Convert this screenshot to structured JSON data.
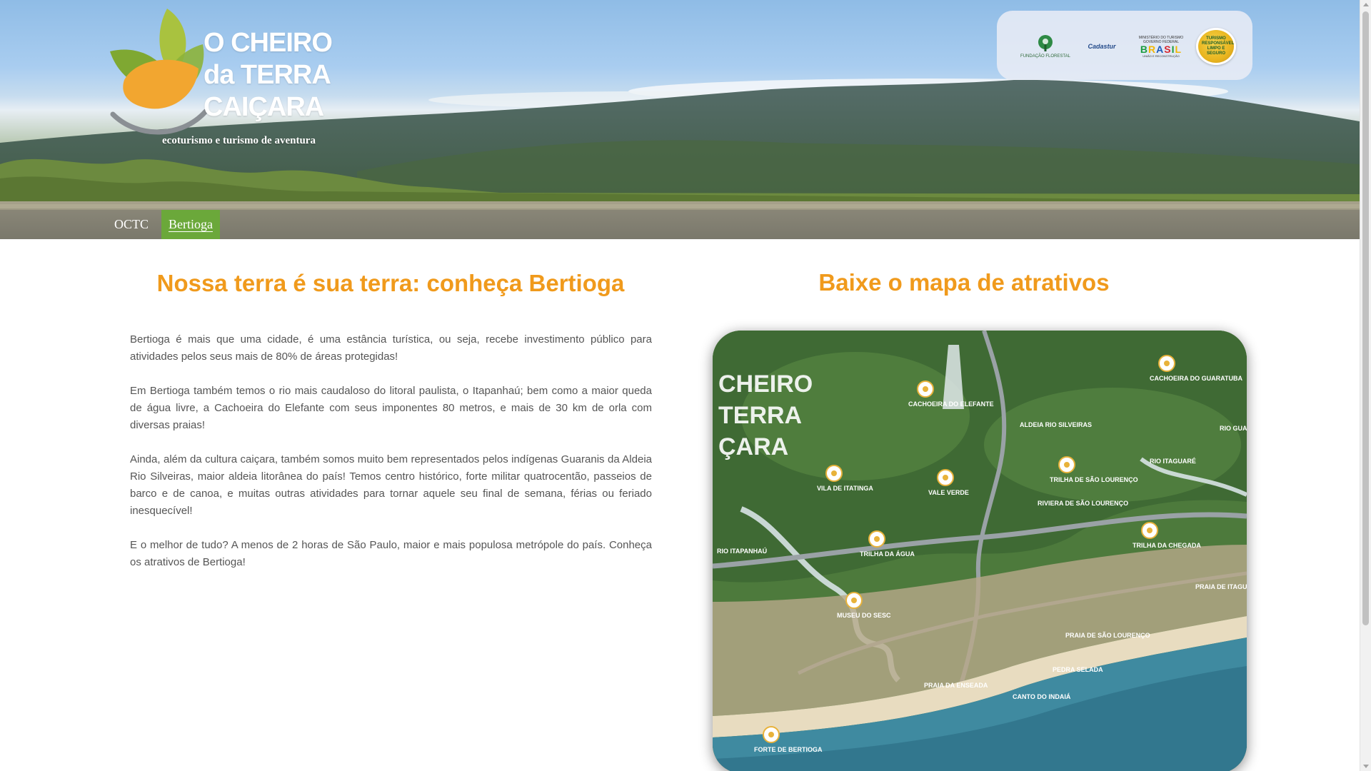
{
  "header": {
    "logo_text": "O CHEIRO\nda TERRA\nCAIÇARA",
    "tagline": "ecoturismo e turismo de aventura"
  },
  "partners": {
    "fundacao": "FUNDAÇÃO FLORESTAL",
    "cadastur": "Cadastur",
    "brasil_top": "MINISTÉRIO DO TURISMO",
    "brasil_mid": "GOVERNO FEDERAL",
    "brasil_word": [
      "B",
      "R",
      "A",
      "S",
      "I",
      "L"
    ],
    "brasil_sub": "UNIÃO E RECONSTRUÇÃO",
    "turismo_seal": "TURISMO RESPONSÁVEL LIMPO E SEGURO"
  },
  "nav": {
    "items": [
      {
        "label": "OCTC"
      },
      {
        "label": "Bertioga",
        "active": true
      }
    ]
  },
  "left": {
    "title": "Nossa terra é sua terra: conheça Bertioga",
    "paragraphs": [
      "Bertioga é mais que uma cidade, é uma estância turística, ou seja, recebe investimento público para atividades pelos seus mais de 80% de áreas protegidas!",
      "Em Bertioga também temos o rio mais caudaloso do litoral paulista, o Itapanhaú; bem como a maior queda de água livre, a Cachoeira do Elefante com seus imponentes 80 metros, e mais de 30 km de orla com diversas praias!",
      "Ainda, além da cultura caiçara, também somos muito bem representados pelos indígenas Guaranis da Aldeia Rio Silveiras, maior aldeia litorânea do país! Temos centro histórico, forte militar quatrocentão, passeios de barco e de canoa, e muitas outras atividades para tornar aquele seu final de semana, férias ou feriado inesquecível!",
      "E o melhor de tudo? A menos de 2 horas de São Paulo, maior e mais populosa metrópole do país. Conheça os atrativos de Bertioga!"
    ]
  },
  "right": {
    "title": "Baixe o mapa de atrativos",
    "map_brand": "CHEIRO\nTERRA\nÇARA",
    "map_labels": {
      "cachoeira_elefante": "CACHOEIRA DO ELEFANTE",
      "cachoeira_guaratuba": "CACHOEIRA DO GUARATUBA",
      "rio_guaratuba": "RIO GUARATUBA",
      "rio_itaguare": "RIO ITAGUARÉ",
      "aldeia": "ALDEIA RIO SILVEIRAS",
      "vila_itatinga": "VILA DE ITATINGA",
      "vale_verde": "VALE VERDE",
      "trilha_sao_lourenco": "TRILHA DE SÃO LOURENÇO",
      "riviera": "RIVIERA DE SÃO LOURENÇO",
      "rio_itapanhau": "RIO ITAPANHAÚ",
      "trilha_agua": "TRILHA DA ÁGUA",
      "trilha_chegada": "TRILHA DA CHEGADA",
      "praia_itaguare": "PRAIA DE ITAGUARÉ",
      "museu": "MUSEU DO SESC",
      "praia_sao_lourenco": "PRAIA DE SÃO LOURENÇO",
      "pedra_selada": "PEDRA SELADA",
      "praia_enseada": "PRAIA DA ENSEADA",
      "canto_indaia": "CANTO DO INDAIÁ",
      "forte": "FORTE DE BERTIOGA"
    }
  },
  "colors": {
    "accent_orange": "#f09a1c",
    "nav_active": "#6ba83a",
    "body_text": "#555555"
  }
}
